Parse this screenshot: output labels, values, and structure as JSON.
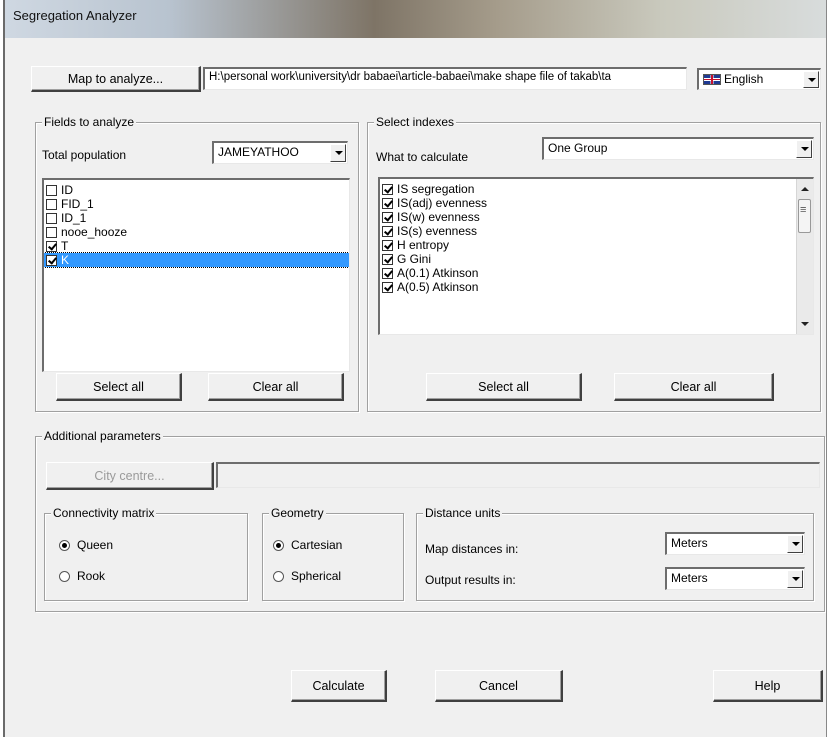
{
  "window": {
    "title": "Segregation Analyzer"
  },
  "map": {
    "button_label": "Map to analyze...",
    "path_value": "H:\\personal work\\university\\dr babaei\\article-babaei\\make shape file of takab\\ta"
  },
  "language": {
    "selected": "English",
    "flag_icon": "uk-flag-icon"
  },
  "fields": {
    "legend": "Fields to analyze",
    "total_population_label": "Total population",
    "total_population_value": "JAMEYATHOO",
    "items": [
      {
        "label": "ID",
        "checked": false
      },
      {
        "label": "FID_1",
        "checked": false
      },
      {
        "label": "ID_1",
        "checked": false
      },
      {
        "label": "nooe_hooze",
        "checked": false
      },
      {
        "label": "T",
        "checked": true
      },
      {
        "label": "K",
        "checked": true,
        "selected": true
      }
    ],
    "select_all_label": "Select all",
    "clear_all_label": "Clear all"
  },
  "indexes": {
    "legend": "Select indexes",
    "what_label": "What to calculate",
    "what_value": "One Group",
    "items": [
      {
        "label": "IS segregation",
        "checked": true
      },
      {
        "label": "IS(adj) evenness",
        "checked": true
      },
      {
        "label": "IS(w) evenness",
        "checked": true
      },
      {
        "label": "IS(s) evenness",
        "checked": true
      },
      {
        "label": "H entropy",
        "checked": true
      },
      {
        "label": "G Gini",
        "checked": true
      },
      {
        "label": "A(0.1) Atkinson",
        "checked": true
      },
      {
        "label": "A(0.5) Atkinson",
        "checked": true
      }
    ],
    "select_all_label": "Select all",
    "clear_all_label": "Clear all"
  },
  "additional": {
    "legend": "Additional parameters",
    "city_centre_label": "City centre...",
    "city_centre_value": "",
    "connectivity": {
      "legend": "Connectivity matrix",
      "options": [
        {
          "label": "Queen",
          "checked": true
        },
        {
          "label": "Rook",
          "checked": false
        }
      ]
    },
    "geometry": {
      "legend": "Geometry",
      "options": [
        {
          "label": "Cartesian",
          "checked": true
        },
        {
          "label": "Spherical",
          "checked": false
        }
      ]
    },
    "distance": {
      "legend": "Distance units",
      "map_label": "Map distances in:",
      "map_value": "Meters",
      "output_label": "Output results in:",
      "output_value": "Meters"
    }
  },
  "footer": {
    "calculate_label": "Calculate",
    "cancel_label": "Cancel",
    "help_label": "Help"
  }
}
